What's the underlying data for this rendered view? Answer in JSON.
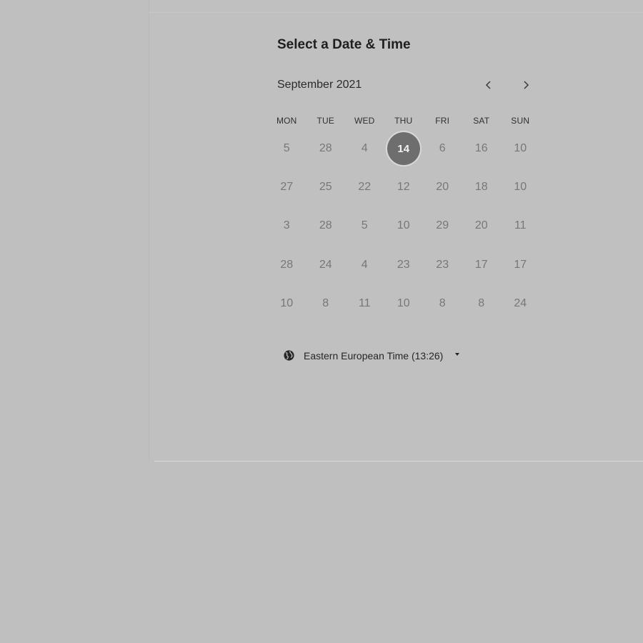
{
  "scheduler": {
    "title": "Select a Date & Time",
    "month_label": "September 2021",
    "nav": {
      "prev_icon": "chevron-left-icon",
      "next_icon": "chevron-right-icon"
    },
    "weekdays": [
      "MON",
      "TUE",
      "WED",
      "THU",
      "FRI",
      "SAT",
      "SUN"
    ],
    "weeks": [
      [
        "5",
        "28",
        "4",
        "14",
        "6",
        "16",
        "10"
      ],
      [
        "27",
        "25",
        "22",
        "12",
        "20",
        "18",
        "10"
      ],
      [
        "3",
        "28",
        "5",
        "10",
        "29",
        "20",
        "11"
      ],
      [
        "28",
        "24",
        "4",
        "23",
        "23",
        "17",
        "17"
      ],
      [
        "10",
        "8",
        "11",
        "10",
        "8",
        "8",
        "24"
      ]
    ],
    "selected_day": "14",
    "timezone": {
      "icon": "globe-icon",
      "label": "Eastern European Time (13:26)"
    }
  },
  "colors": {
    "page_background": "#bfbfbf",
    "selected_day_fill": "#6e6e6e",
    "day_text": "#777777",
    "heading_text": "#1f1f1f"
  }
}
